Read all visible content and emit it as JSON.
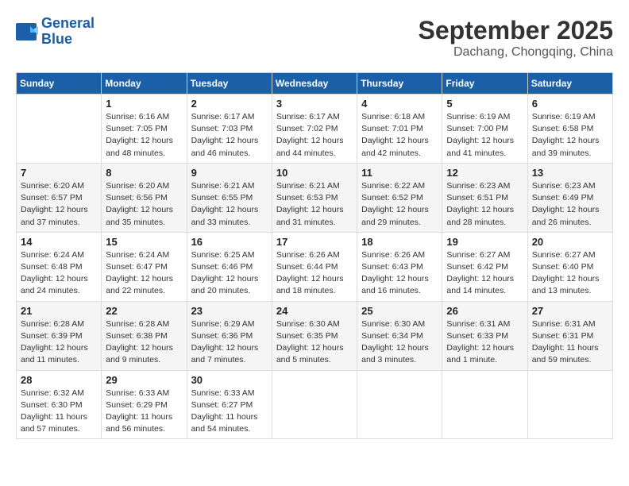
{
  "header": {
    "logo_line1": "General",
    "logo_line2": "Blue",
    "month": "September 2025",
    "location": "Dachang, Chongqing, China"
  },
  "weekdays": [
    "Sunday",
    "Monday",
    "Tuesday",
    "Wednesday",
    "Thursday",
    "Friday",
    "Saturday"
  ],
  "weeks": [
    [
      {
        "day": "",
        "info": ""
      },
      {
        "day": "1",
        "info": "Sunrise: 6:16 AM\nSunset: 7:05 PM\nDaylight: 12 hours\nand 48 minutes."
      },
      {
        "day": "2",
        "info": "Sunrise: 6:17 AM\nSunset: 7:03 PM\nDaylight: 12 hours\nand 46 minutes."
      },
      {
        "day": "3",
        "info": "Sunrise: 6:17 AM\nSunset: 7:02 PM\nDaylight: 12 hours\nand 44 minutes."
      },
      {
        "day": "4",
        "info": "Sunrise: 6:18 AM\nSunset: 7:01 PM\nDaylight: 12 hours\nand 42 minutes."
      },
      {
        "day": "5",
        "info": "Sunrise: 6:19 AM\nSunset: 7:00 PM\nDaylight: 12 hours\nand 41 minutes."
      },
      {
        "day": "6",
        "info": "Sunrise: 6:19 AM\nSunset: 6:58 PM\nDaylight: 12 hours\nand 39 minutes."
      }
    ],
    [
      {
        "day": "7",
        "info": "Sunrise: 6:20 AM\nSunset: 6:57 PM\nDaylight: 12 hours\nand 37 minutes."
      },
      {
        "day": "8",
        "info": "Sunrise: 6:20 AM\nSunset: 6:56 PM\nDaylight: 12 hours\nand 35 minutes."
      },
      {
        "day": "9",
        "info": "Sunrise: 6:21 AM\nSunset: 6:55 PM\nDaylight: 12 hours\nand 33 minutes."
      },
      {
        "day": "10",
        "info": "Sunrise: 6:21 AM\nSunset: 6:53 PM\nDaylight: 12 hours\nand 31 minutes."
      },
      {
        "day": "11",
        "info": "Sunrise: 6:22 AM\nSunset: 6:52 PM\nDaylight: 12 hours\nand 29 minutes."
      },
      {
        "day": "12",
        "info": "Sunrise: 6:23 AM\nSunset: 6:51 PM\nDaylight: 12 hours\nand 28 minutes."
      },
      {
        "day": "13",
        "info": "Sunrise: 6:23 AM\nSunset: 6:49 PM\nDaylight: 12 hours\nand 26 minutes."
      }
    ],
    [
      {
        "day": "14",
        "info": "Sunrise: 6:24 AM\nSunset: 6:48 PM\nDaylight: 12 hours\nand 24 minutes."
      },
      {
        "day": "15",
        "info": "Sunrise: 6:24 AM\nSunset: 6:47 PM\nDaylight: 12 hours\nand 22 minutes."
      },
      {
        "day": "16",
        "info": "Sunrise: 6:25 AM\nSunset: 6:46 PM\nDaylight: 12 hours\nand 20 minutes."
      },
      {
        "day": "17",
        "info": "Sunrise: 6:26 AM\nSunset: 6:44 PM\nDaylight: 12 hours\nand 18 minutes."
      },
      {
        "day": "18",
        "info": "Sunrise: 6:26 AM\nSunset: 6:43 PM\nDaylight: 12 hours\nand 16 minutes."
      },
      {
        "day": "19",
        "info": "Sunrise: 6:27 AM\nSunset: 6:42 PM\nDaylight: 12 hours\nand 14 minutes."
      },
      {
        "day": "20",
        "info": "Sunrise: 6:27 AM\nSunset: 6:40 PM\nDaylight: 12 hours\nand 13 minutes."
      }
    ],
    [
      {
        "day": "21",
        "info": "Sunrise: 6:28 AM\nSunset: 6:39 PM\nDaylight: 12 hours\nand 11 minutes."
      },
      {
        "day": "22",
        "info": "Sunrise: 6:28 AM\nSunset: 6:38 PM\nDaylight: 12 hours\nand 9 minutes."
      },
      {
        "day": "23",
        "info": "Sunrise: 6:29 AM\nSunset: 6:36 PM\nDaylight: 12 hours\nand 7 minutes."
      },
      {
        "day": "24",
        "info": "Sunrise: 6:30 AM\nSunset: 6:35 PM\nDaylight: 12 hours\nand 5 minutes."
      },
      {
        "day": "25",
        "info": "Sunrise: 6:30 AM\nSunset: 6:34 PM\nDaylight: 12 hours\nand 3 minutes."
      },
      {
        "day": "26",
        "info": "Sunrise: 6:31 AM\nSunset: 6:33 PM\nDaylight: 12 hours\nand 1 minute."
      },
      {
        "day": "27",
        "info": "Sunrise: 6:31 AM\nSunset: 6:31 PM\nDaylight: 11 hours\nand 59 minutes."
      }
    ],
    [
      {
        "day": "28",
        "info": "Sunrise: 6:32 AM\nSunset: 6:30 PM\nDaylight: 11 hours\nand 57 minutes."
      },
      {
        "day": "29",
        "info": "Sunrise: 6:33 AM\nSunset: 6:29 PM\nDaylight: 11 hours\nand 56 minutes."
      },
      {
        "day": "30",
        "info": "Sunrise: 6:33 AM\nSunset: 6:27 PM\nDaylight: 11 hours\nand 54 minutes."
      },
      {
        "day": "",
        "info": ""
      },
      {
        "day": "",
        "info": ""
      },
      {
        "day": "",
        "info": ""
      },
      {
        "day": "",
        "info": ""
      }
    ]
  ]
}
